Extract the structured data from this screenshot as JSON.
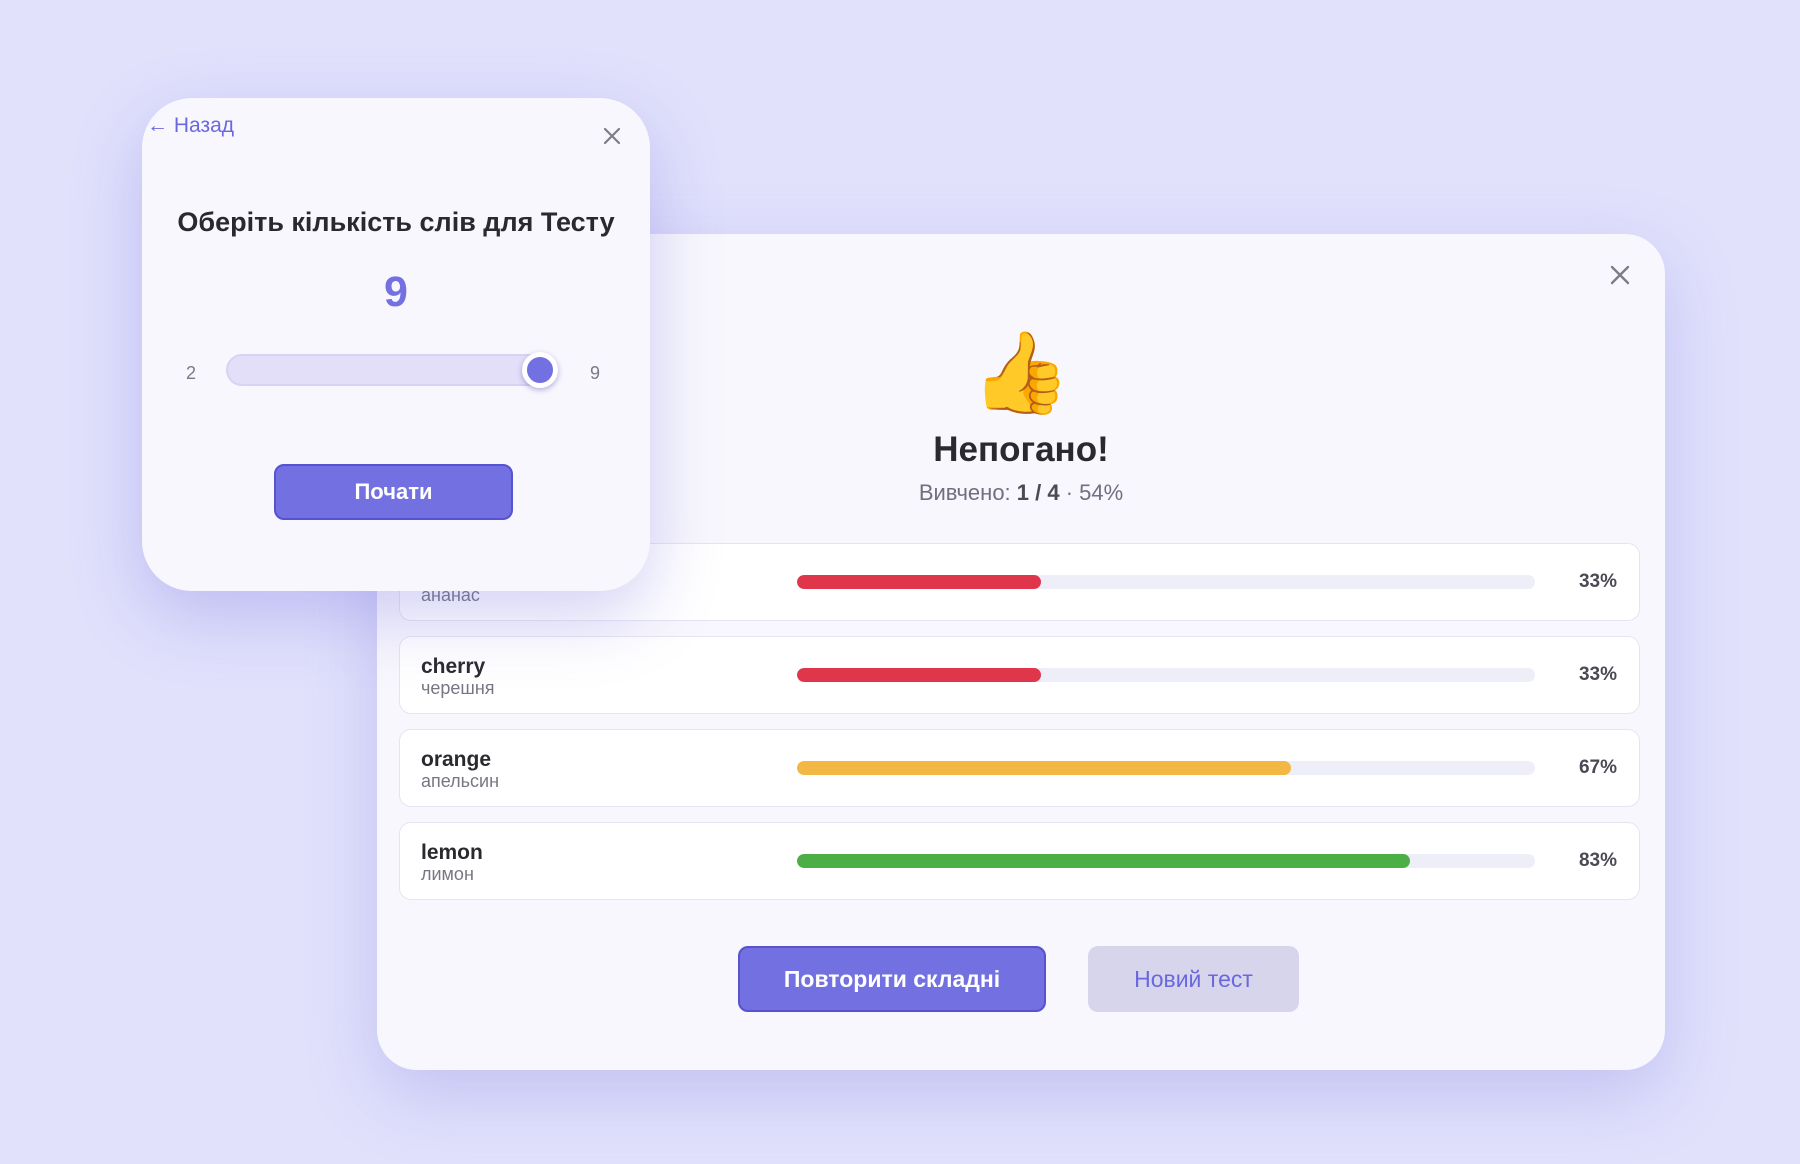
{
  "results": {
    "emoji": "👍",
    "title": "Непогано!",
    "subtitle_prefix": "Вивчено: ",
    "learned": "1 / 4",
    "subtitle_suffix": " · 54%",
    "close_icon": "close-icon",
    "words": [
      {
        "en": "",
        "uk": "ананас",
        "percent_label": "33%",
        "progress": 0.33,
        "color": "#e0364b"
      },
      {
        "en": "cherry",
        "uk": "черешня",
        "percent_label": "33%",
        "progress": 0.33,
        "color": "#e0364b"
      },
      {
        "en": "orange",
        "uk": "апельсин",
        "percent_label": "67%",
        "progress": 0.67,
        "color": "#f2b843"
      },
      {
        "en": "lemon",
        "uk": "лимон",
        "percent_label": "83%",
        "progress": 0.83,
        "color": "#4caf45"
      }
    ],
    "repeat_label": "Повторити складні",
    "new_test_label": "Новий тест"
  },
  "count_dialog": {
    "back_label": "← Назад",
    "close_icon": "close-icon",
    "title": "Оберіть кількість слів для Тесту",
    "value": "9",
    "min_label": "2",
    "max_label": "9",
    "slider_min": 2,
    "slider_max": 9,
    "slider_value": 9,
    "start_label": "Почати"
  },
  "colors": {
    "accent": "#7370e2",
    "background": "#e1e1fc",
    "card": "#f8f7fd",
    "bar_low": "#e0364b",
    "bar_mid": "#f2b843",
    "bar_high": "#4caf45"
  }
}
